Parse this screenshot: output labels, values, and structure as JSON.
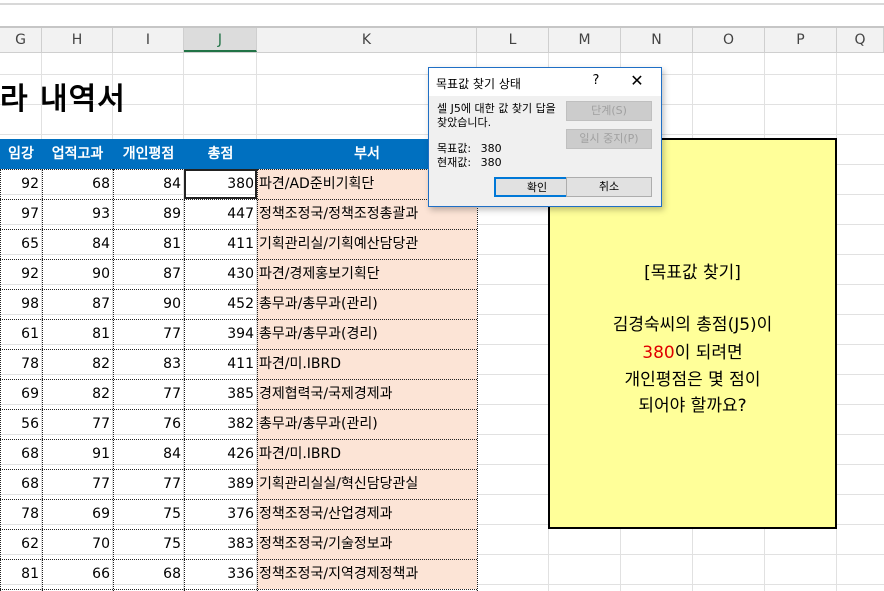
{
  "columns": [
    {
      "label": "G",
      "sel": false
    },
    {
      "label": "H",
      "sel": false
    },
    {
      "label": "I",
      "sel": false
    },
    {
      "label": "J",
      "sel": true
    },
    {
      "label": "K",
      "sel": false
    },
    {
      "label": "L",
      "sel": false
    },
    {
      "label": "M",
      "sel": false
    },
    {
      "label": "N",
      "sel": false
    },
    {
      "label": "O",
      "sel": false
    },
    {
      "label": "P",
      "sel": false
    },
    {
      "label": "Q",
      "sel": false
    }
  ],
  "sheet": {
    "title": "라 내역서",
    "headers": {
      "col_g": "임강",
      "col_h": "업적고과",
      "col_i": "개인평점",
      "col_j": "총점",
      "col_k": "부서"
    },
    "rows": [
      {
        "g": "92",
        "h": "68",
        "i": "84",
        "j": "380",
        "dept": "파견/AD준비기획단"
      },
      {
        "g": "97",
        "h": "93",
        "i": "89",
        "j": "447",
        "dept": "정책조정국/정책조정총괄과"
      },
      {
        "g": "65",
        "h": "84",
        "i": "81",
        "j": "411",
        "dept": "기획관리실/기획예산담당관"
      },
      {
        "g": "92",
        "h": "90",
        "i": "87",
        "j": "430",
        "dept": "파견/경제홍보기획단"
      },
      {
        "g": "98",
        "h": "87",
        "i": "90",
        "j": "452",
        "dept": "총무과/총무과(관리)"
      },
      {
        "g": "61",
        "h": "81",
        "i": "77",
        "j": "394",
        "dept": "총무과/총무과(경리)"
      },
      {
        "g": "78",
        "h": "82",
        "i": "83",
        "j": "411",
        "dept": "파견/미.IBRD"
      },
      {
        "g": "69",
        "h": "82",
        "i": "77",
        "j": "385",
        "dept": "경제협력국/국제경제과"
      },
      {
        "g": "56",
        "h": "77",
        "i": "76",
        "j": "382",
        "dept": "총무과/총무과(관리)"
      },
      {
        "g": "68",
        "h": "91",
        "i": "84",
        "j": "426",
        "dept": "파견/미.IBRD"
      },
      {
        "g": "68",
        "h": "77",
        "i": "77",
        "j": "389",
        "dept": "기획관리실실/혁신담당관실"
      },
      {
        "g": "78",
        "h": "69",
        "i": "75",
        "j": "376",
        "dept": "정책조정국/산업경제과"
      },
      {
        "g": "62",
        "h": "70",
        "i": "75",
        "j": "383",
        "dept": "정책조정국/기술정보과"
      },
      {
        "g": "81",
        "h": "66",
        "i": "68",
        "j": "336",
        "dept": "정책조정국/지역경제정책과"
      }
    ]
  },
  "note": {
    "heading": "[목표값 찾기]",
    "line1": "김경숙씨의 총점(J5)이",
    "line2_red": "380",
    "line2_rest": "이 되려면",
    "line3": "개인평점은 몇 점이",
    "line4": "되어야 할까요?"
  },
  "dialog": {
    "title": "목표값 찾기 상태",
    "help_glyph": "?",
    "close_glyph": "✕",
    "message": "셀 J5에 대한 값 찾기 답을 찾았습니다.",
    "target_label": "목표값:",
    "target_value": "380",
    "current_label": "현재값:",
    "current_value": "380",
    "step_button": "단계(S)",
    "pause_button": "일시 중지(P)",
    "ok_button": "확인",
    "cancel_button": "취소"
  },
  "colors": {
    "header_blue": "#0070c0",
    "dept_fill": "#fce4d6",
    "note_fill": "#ffff99",
    "accent_green": "#217346"
  }
}
